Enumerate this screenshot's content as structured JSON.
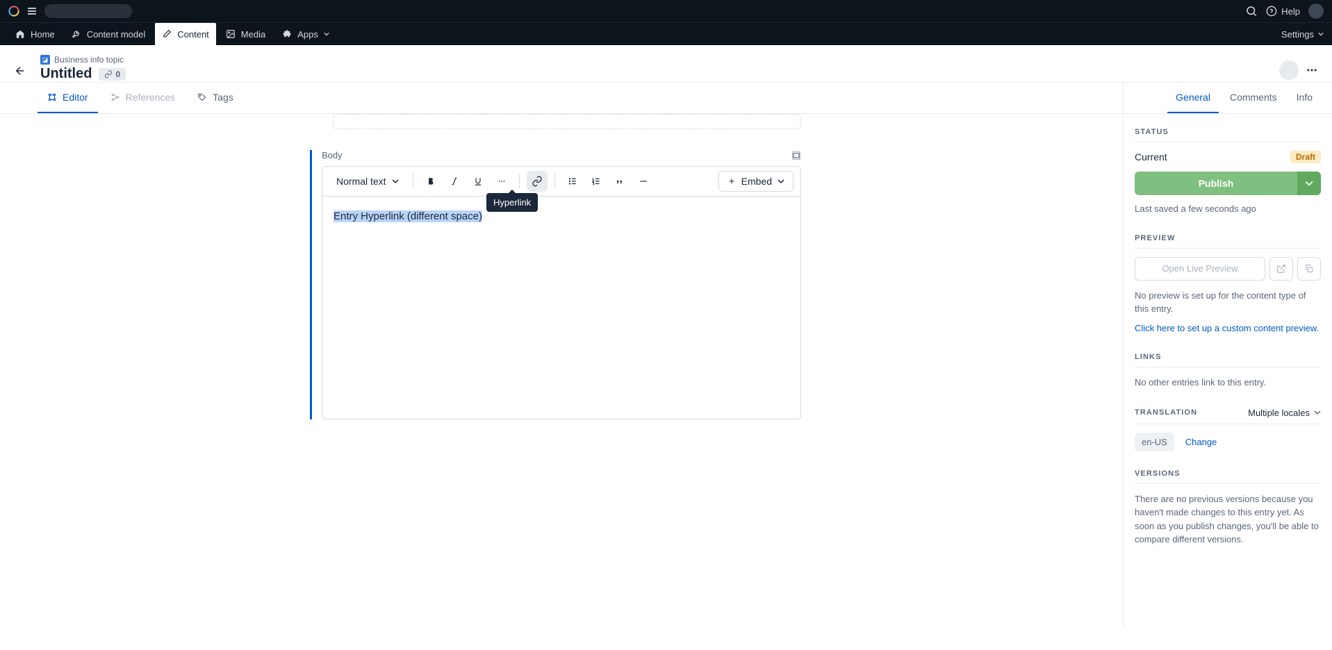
{
  "topbar": {
    "help": "Help"
  },
  "nav": {
    "home": "Home",
    "content_model": "Content model",
    "content": "Content",
    "media": "Media",
    "apps": "Apps",
    "settings": "Settings"
  },
  "entry": {
    "content_type": "Business info topic",
    "title": "Untitled",
    "link_count": "0"
  },
  "tabs": {
    "editor": "Editor",
    "references": "References",
    "tags": "Tags"
  },
  "sidebar_tabs": {
    "general": "General",
    "comments": "Comments",
    "info": "Info"
  },
  "status": {
    "heading": "STATUS",
    "current_label": "Current",
    "badge": "Draft",
    "publish": "Publish",
    "last_saved": "Last saved a few seconds ago"
  },
  "preview": {
    "heading": "PREVIEW",
    "button": "Open Live Preview",
    "no_preview": "No preview is set up for the content type of this entry.",
    "setup_link": "Click here to set up a custom content preview."
  },
  "links_section": {
    "heading": "LINKS",
    "text": "No other entries link to this entry."
  },
  "translation": {
    "heading": "TRANSLATION",
    "selector": "Multiple locales",
    "locale": "en-US",
    "change": "Change"
  },
  "versions": {
    "heading": "VERSIONS",
    "text": "There are no previous versions because you haven't made changes to this entry yet. As soon as you publish changes, you'll be able to compare different versions."
  },
  "rte": {
    "field_label": "Body",
    "text_style": "Normal text",
    "embed": "Embed",
    "tooltip": "Hyperlink",
    "content_text": "Entry Hyperlink (different space)"
  }
}
